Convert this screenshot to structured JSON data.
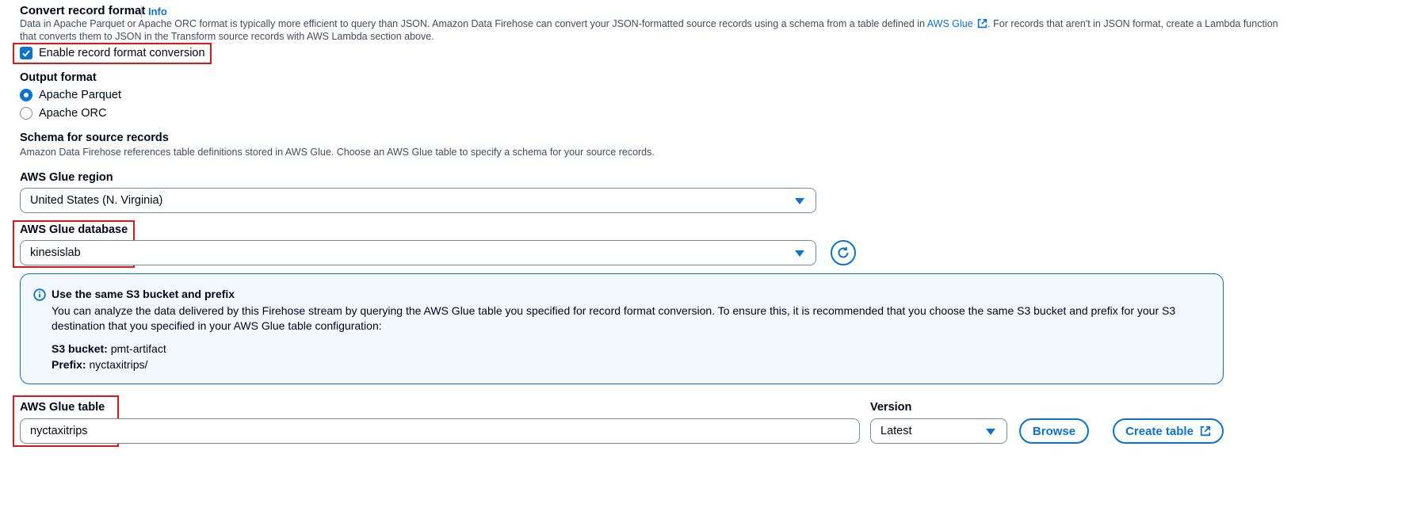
{
  "convert": {
    "title": "Convert record format",
    "info": "Info",
    "desc_part1": "Data in Apache Parquet or Apache ORC format is typically more efficient to query than JSON. Amazon Data Firehose can convert your JSON-formatted source records using a schema from a table defined in ",
    "glue_link": "AWS Glue",
    "desc_part2": ". For records that aren't in JSON format, create a Lambda function",
    "desc_line2": "that converts them to JSON in the Transform source records with AWS Lambda section above.",
    "enable_label": "Enable record format conversion",
    "enable_checked": true
  },
  "output": {
    "label": "Output format",
    "options": [
      "Apache Parquet",
      "Apache ORC"
    ],
    "selected": "Apache Parquet"
  },
  "schema": {
    "title": "Schema for source records",
    "desc": "Amazon Data Firehose references table definitions stored in AWS Glue. Choose an AWS Glue table to specify a schema for your source records."
  },
  "region": {
    "label": "AWS Glue region",
    "value": "United States (N. Virginia)"
  },
  "database": {
    "label": "AWS Glue database",
    "value": "kinesislab"
  },
  "alert": {
    "title": "Use the same S3 bucket and prefix",
    "body_line1": "You can analyze the data delivered by this Firehose stream by querying the AWS Glue table you specified for record format conversion. To ensure this, it is recommended that you choose the same S3 bucket and prefix for your S3",
    "body_line2": "destination that you specified in your AWS Glue table configuration:",
    "bucket_label": "S3 bucket:",
    "bucket_value": "pmt-artifact",
    "prefix_label": "Prefix:",
    "prefix_value": "nyctaxitrips/"
  },
  "table": {
    "label": "AWS Glue table",
    "value": "nyctaxitrips"
  },
  "version": {
    "label": "Version",
    "value": "Latest"
  },
  "buttons": {
    "browse": "Browse",
    "create_table": "Create table"
  },
  "colors": {
    "accent": "#0972d3",
    "highlight": "#e0151a",
    "alert_bg": "#f2f8fd"
  },
  "icons": [
    "external-link-icon",
    "refresh-icon",
    "info-circle-icon",
    "check-icon",
    "caret-down-icon"
  ]
}
